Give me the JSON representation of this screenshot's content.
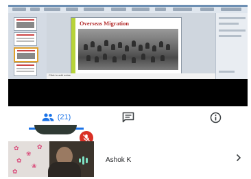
{
  "shared_screen": {
    "slide_title": "Overseas Migration",
    "notes_placeholder": "Click to add notes"
  },
  "tabs": {
    "people_count": "(21)",
    "active": "people"
  },
  "participants": [
    {
      "name": "Ashok K"
    }
  ],
  "colors": {
    "accent": "#1a73e8",
    "mute_badge": "#d93025",
    "voice_indicator": "#7ee3c5",
    "slide_title": "#b22a2a"
  },
  "icons": [
    "people-icon",
    "chat-icon",
    "info-icon",
    "mic-off-icon",
    "voice-activity-icon",
    "chevron-right-icon"
  ]
}
